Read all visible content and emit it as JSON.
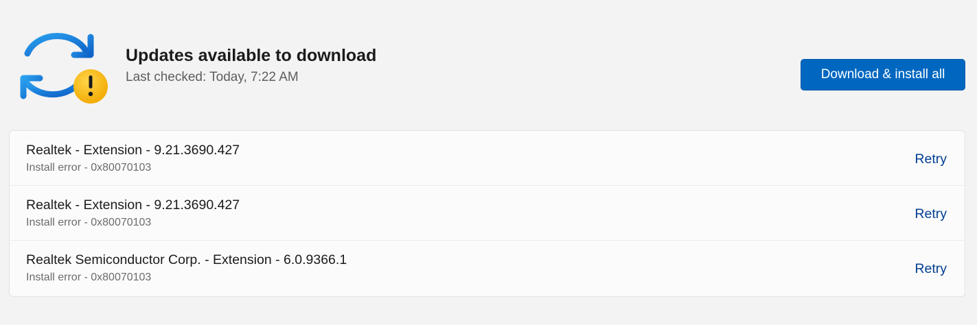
{
  "header": {
    "title": "Updates available to download",
    "subtitle": "Last checked: Today, 7:22 AM",
    "primary_action_label": "Download & install all",
    "icon": "sync-warning-icon"
  },
  "updates": [
    {
      "name": "Realtek - Extension - 9.21.3690.427",
      "status": "Install error - 0x80070103",
      "action": "Retry"
    },
    {
      "name": "Realtek - Extension - 9.21.3690.427",
      "status": "Install error - 0x80070103",
      "action": "Retry"
    },
    {
      "name": "Realtek Semiconductor Corp. - Extension - 6.0.9366.1",
      "status": "Install error - 0x80070103",
      "action": "Retry"
    }
  ],
  "colors": {
    "accent": "#0067c0",
    "link": "#003e92",
    "warning": "#f7b500",
    "sync_blue": "#1a86d9"
  }
}
